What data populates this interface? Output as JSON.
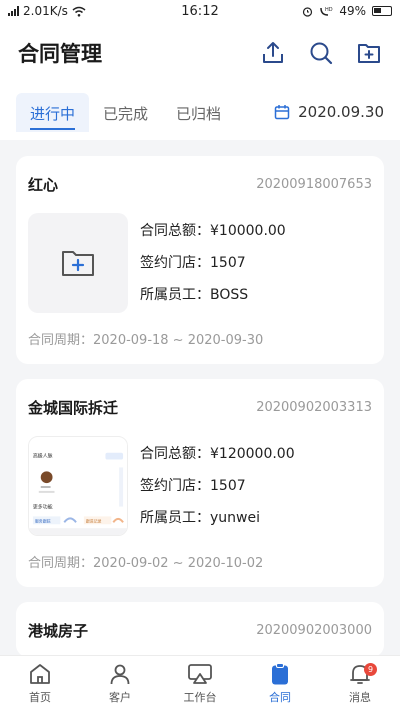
{
  "status_bar": {
    "network": "2.01K/s",
    "time": "16:12",
    "battery": "49%"
  },
  "header": {
    "title": "合同管理"
  },
  "tabs": [
    {
      "label": "进行中",
      "active": true
    },
    {
      "label": "已完成",
      "active": false
    },
    {
      "label": "已归档",
      "active": false
    }
  ],
  "date_filter": "2020.09.30",
  "contracts": [
    {
      "name": "红心",
      "number": "20200918007653",
      "total": "合同总额：¥10000.00",
      "store": "签约门店：1507",
      "staff": "所属员工：BOSS",
      "period": "合同周期：2020-09-18 ~ 2020-09-30",
      "thumb": "empty-folder"
    },
    {
      "name": "金城国际拆迁",
      "number": "20200902003313",
      "total": "合同总额：¥120000.00",
      "store": "签约门店：1507",
      "staff": "所属员工：yunwei",
      "period": "合同周期：2020-09-02 ~ 2020-10-02",
      "thumb": "screenshot"
    },
    {
      "name": "港城房子",
      "number": "20200902003000"
    }
  ],
  "thumb_texts": {
    "a": "高級人脉",
    "b": "更多功能",
    "c": "服务跟踪",
    "d": "跟进记录"
  },
  "nav": [
    {
      "label": "首页",
      "icon": "home-icon"
    },
    {
      "label": "客户",
      "icon": "person-icon"
    },
    {
      "label": "工作台",
      "icon": "workbench-icon"
    },
    {
      "label": "合同",
      "icon": "clipboard-icon",
      "active": true
    },
    {
      "label": "消息",
      "icon": "bell-icon",
      "badge": "9"
    }
  ],
  "colors": {
    "accent": "#2b6fd6",
    "badge": "#e8483b"
  }
}
